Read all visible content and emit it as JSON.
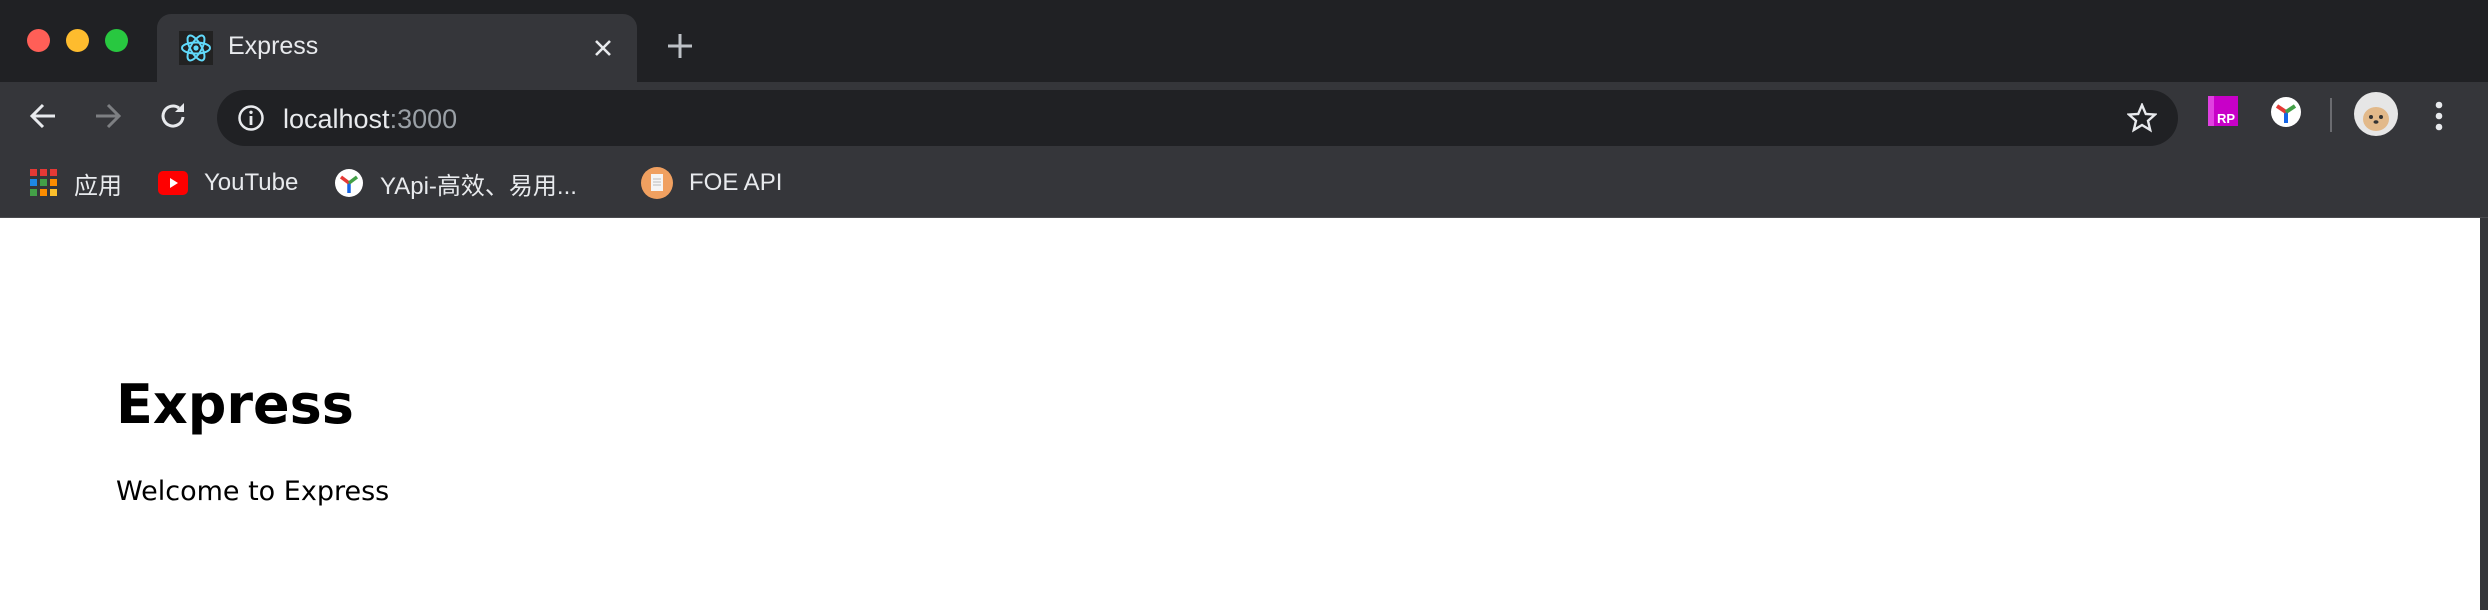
{
  "window": {
    "controls": [
      "close",
      "minimize",
      "maximize"
    ]
  },
  "tab": {
    "title": "Express",
    "icon": "react-icon"
  },
  "toolbar": {
    "url_host": "localhost",
    "url_port": ":3000"
  },
  "extensions": [
    "axure-rp-icon",
    "yapi-icon"
  ],
  "bookmarks": [
    {
      "label": "应用",
      "icon": "apps-grid-icon"
    },
    {
      "label": "YouTube",
      "icon": "youtube-icon"
    },
    {
      "label": "YApi-高效、易用...",
      "icon": "yapi-icon"
    },
    {
      "label": "FOE API",
      "icon": "document-icon"
    }
  ],
  "page": {
    "heading": "Express",
    "text": "Welcome to Express"
  },
  "colors": {
    "close": "#ff5f57",
    "minimize": "#febc2e",
    "maximize": "#28c840",
    "chrome_dark": "#202124",
    "chrome": "#35363a"
  }
}
